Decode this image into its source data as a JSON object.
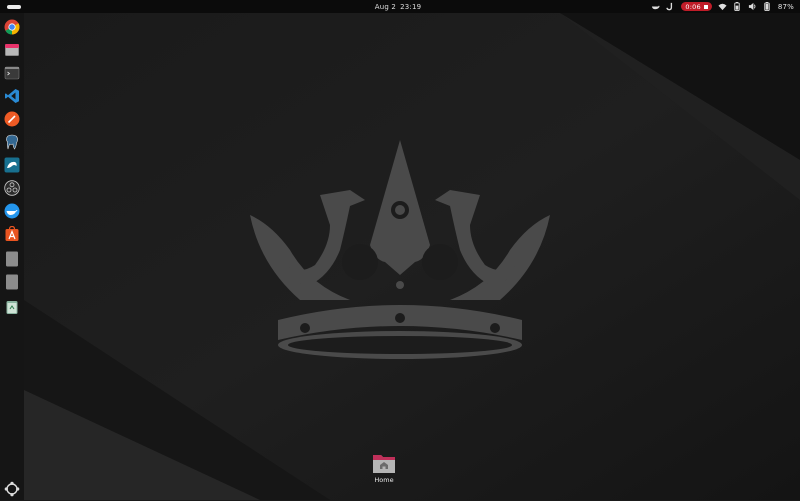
{
  "topbar": {
    "date": "Aug 2",
    "time": "23:19",
    "recording_time": "0:06",
    "battery_percent": "87%",
    "tray_icons": [
      "docker-icon",
      "j-app-icon",
      "screen-record-indicator",
      "wifi-icon",
      "battery-status-icon",
      "volume-icon",
      "battery-icon"
    ]
  },
  "dock": {
    "items": [
      {
        "name": "chrome-icon"
      },
      {
        "name": "files-icon"
      },
      {
        "name": "terminal-icon"
      },
      {
        "name": "vscode-icon"
      },
      {
        "name": "postman-icon"
      },
      {
        "name": "postgres-icon"
      },
      {
        "name": "mysql-workbench-icon"
      },
      {
        "name": "obs-icon"
      },
      {
        "name": "docker-desktop-icon"
      },
      {
        "name": "app-center-icon"
      },
      {
        "name": "generic-app-icon"
      },
      {
        "name": "generic-app-2-icon"
      },
      {
        "name": "trash-icon"
      }
    ],
    "apps_grid_icon": "show-apps-icon"
  },
  "desktop": {
    "home_label": "Home"
  },
  "colors": {
    "topbar": "#0b0b0b",
    "dock": "#151515",
    "wallpaper": "#1d1d1d",
    "crown": "#4a4a4a",
    "record": "#c01c28"
  }
}
